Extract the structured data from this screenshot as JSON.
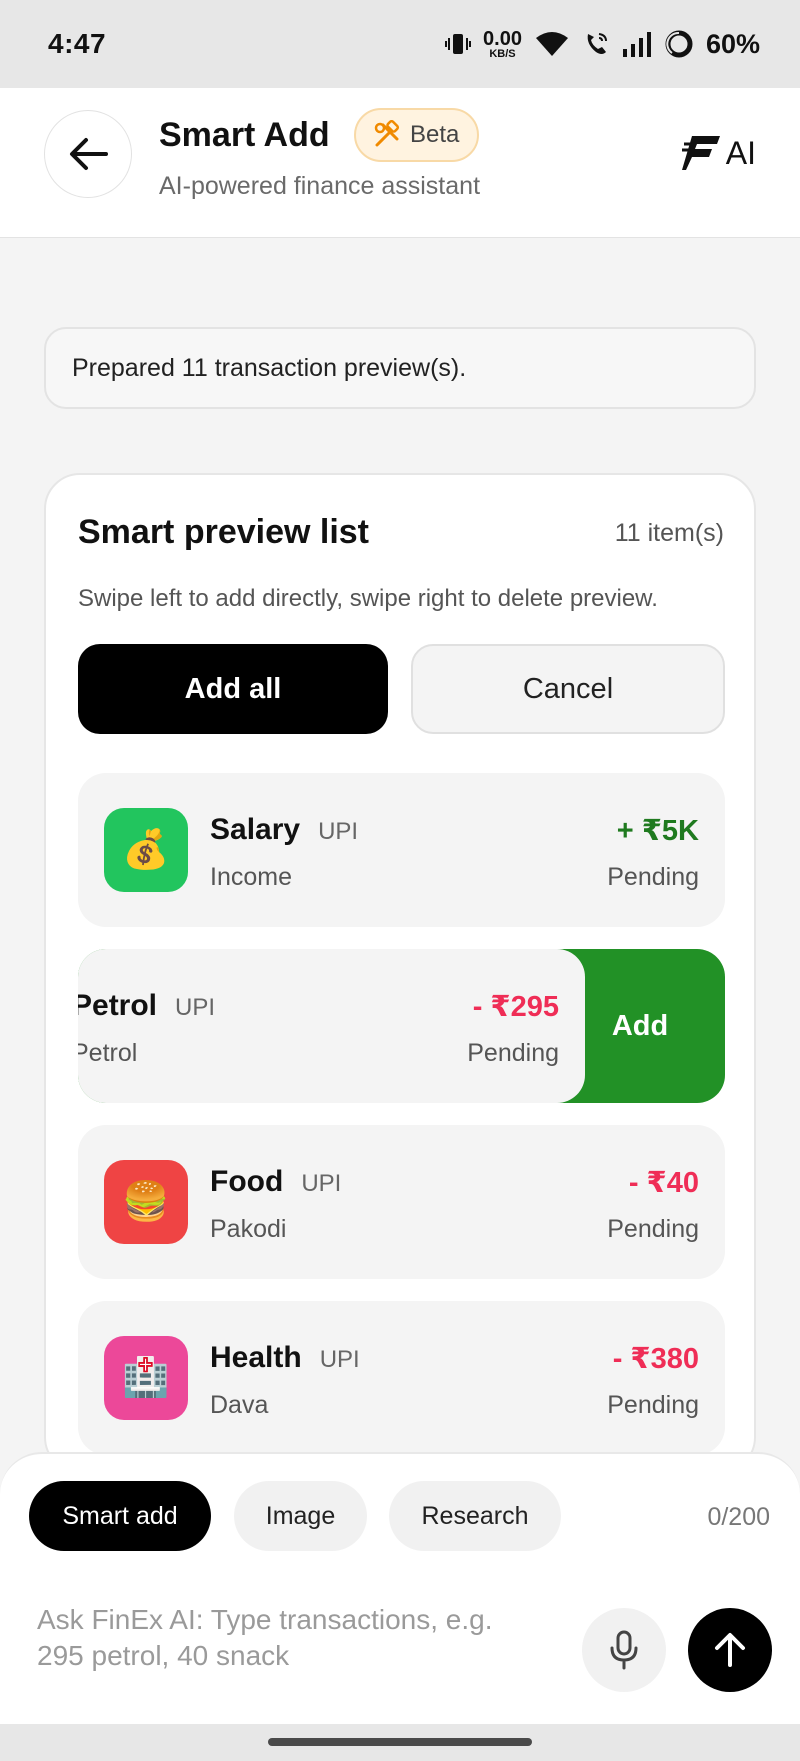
{
  "status_bar": {
    "time": "4:47",
    "net_speed_value": "0.00",
    "net_speed_unit": "KB/S",
    "battery": "60%",
    "icons": [
      "vibrate-icon",
      "wifi-icon",
      "wifi-call-icon",
      "signal-icon",
      "battery-ring-icon"
    ]
  },
  "header": {
    "title": "Smart Add",
    "badge": "Beta",
    "subtitle": "AI-powered finance assistant",
    "ai_label": "AI",
    "back_icon": "arrow-left-icon",
    "badge_icon": "tools-icon"
  },
  "message": "Prepared 11 transaction preview(s).",
  "preview": {
    "title": "Smart preview list",
    "count": "11 item(s)",
    "hint": "Swipe left to add directly, swipe right to delete preview.",
    "add_all_label": "Add all",
    "cancel_label": "Cancel",
    "swipe_action_label": "Add",
    "items": [
      {
        "name": "Salary",
        "method": "UPI",
        "category": "Income",
        "amount": "+ ₹5K",
        "status": "Pending",
        "icon": "money-bag-icon",
        "color": "#22c55e"
      },
      {
        "name": "Petrol",
        "method": "UPI",
        "category": "Petrol",
        "amount": "- ₹295",
        "status": "Pending",
        "icon": "fuel-icon",
        "color": "#f4f4f4"
      },
      {
        "name": "Food",
        "method": "UPI",
        "category": "Pakodi",
        "amount": "- ₹40",
        "status": "Pending",
        "icon": "burger-icon",
        "color": "#ef4444"
      },
      {
        "name": "Health",
        "method": "UPI",
        "category": "Dava",
        "amount": "- ₹380",
        "status": "Pending",
        "icon": "hospital-icon",
        "color": "#ec4899"
      }
    ]
  },
  "composer": {
    "modes": [
      "Smart add",
      "Image",
      "Research"
    ],
    "char_count": "0/200",
    "placeholder_line1": "Ask FinEx AI: Type transactions, e.g.",
    "placeholder_line2": "295 petrol, 40 snack"
  },
  "colors": {
    "income": "#1f7a1f",
    "expense": "#ef2d56",
    "swipe_add": "#229126",
    "primary": "#000000"
  }
}
